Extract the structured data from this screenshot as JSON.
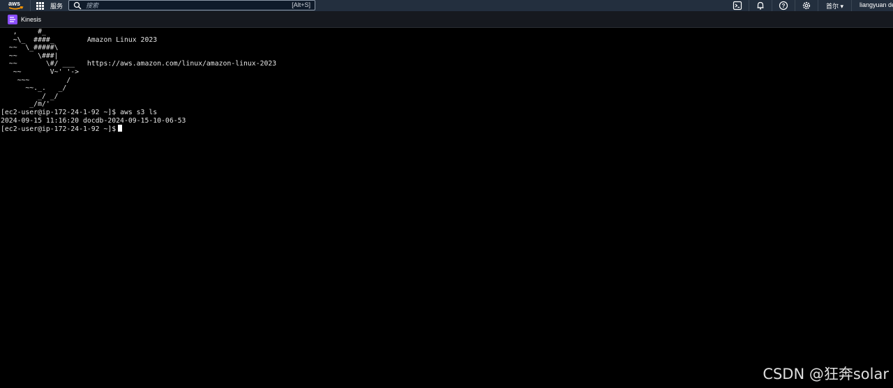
{
  "topnav": {
    "logo_text": "aws",
    "services_label": "服务",
    "search_placeholder": "搜索",
    "search_shortcut": "[Alt+S]",
    "region_label": "首尔 ▾",
    "account_label": "liangyuan de"
  },
  "favorites": {
    "items": [
      {
        "label": "Kinesis",
        "icon": "kinesis-icon"
      }
    ]
  },
  "terminal": {
    "ascii_art": [
      "   ,     #_",
      "   ~\\_  ####_        Amazon Linux 2023",
      "  ~~  \\_#####\\",
      "  ~~     \\###|",
      "  ~~       \\#/ ___   https://aws.amazon.com/linux/amazon-linux-2023",
      "   ~~       V~' '->",
      "    ~~~         /",
      "      ~~._.   _/",
      "         _/ _/",
      "       _/m/'"
    ],
    "prompt": "[ec2-user@ip-172-24-1-92 ~]$",
    "command": "aws s3 ls",
    "output": "2024-09-15 11:16:20 docdb-2024-09-15-10-06-53"
  },
  "watermark": "CSDN @狂奔solar",
  "colors": {
    "nav_bg": "#232f3e",
    "aws_orange": "#ff9900",
    "kinesis_purple": "#8c4fff",
    "terminal_bg": "#000000"
  }
}
